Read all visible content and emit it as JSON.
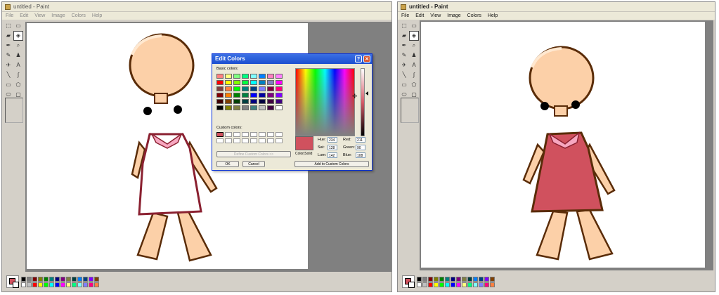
{
  "left_window": {
    "title": "untitled - Paint",
    "menu": [
      "File",
      "Edit",
      "View",
      "Image",
      "Colors",
      "Help"
    ]
  },
  "right_window": {
    "title": "untitled - Paint",
    "menu": [
      "File",
      "Edit",
      "View",
      "Image",
      "Colors",
      "Help"
    ]
  },
  "tools": [
    {
      "icon": "free-form-select-icon",
      "glyph": "⬚"
    },
    {
      "icon": "rect-select-icon",
      "glyph": "▭"
    },
    {
      "icon": "eraser-icon",
      "glyph": "▰"
    },
    {
      "icon": "fill-bucket-icon",
      "glyph": "◈"
    },
    {
      "icon": "color-picker-icon",
      "glyph": "✒"
    },
    {
      "icon": "magnifier-icon",
      "glyph": "⌕"
    },
    {
      "icon": "pencil-icon",
      "glyph": "✎"
    },
    {
      "icon": "brush-icon",
      "glyph": "♟"
    },
    {
      "icon": "airbrush-icon",
      "glyph": "✈"
    },
    {
      "icon": "text-icon",
      "glyph": "A"
    },
    {
      "icon": "line-icon",
      "glyph": "╲"
    },
    {
      "icon": "curve-icon",
      "glyph": "∫"
    },
    {
      "icon": "rectangle-icon",
      "glyph": "▭"
    },
    {
      "icon": "polygon-icon",
      "glyph": "⬠"
    },
    {
      "icon": "ellipse-icon",
      "glyph": "⬭"
    },
    {
      "icon": "rounded-rect-icon",
      "glyph": "▢"
    }
  ],
  "palette": [
    "#000000",
    "#808080",
    "#800000",
    "#808000",
    "#008000",
    "#008080",
    "#000080",
    "#800080",
    "#808040",
    "#004040",
    "#0080ff",
    "#004080",
    "#8000ff",
    "#804000",
    "#ffffff",
    "#c0c0c0",
    "#ff0000",
    "#ffff00",
    "#00ff00",
    "#00ffff",
    "#0000ff",
    "#ff00ff",
    "#ffff80",
    "#00ff80",
    "#80ffff",
    "#8080ff",
    "#ff0080",
    "#ff8040"
  ],
  "colors": {
    "dress": "#d0515e",
    "skin": "#fcd0a8",
    "skin_shade": "#f1b07c",
    "outline": "#5a2c08",
    "collar": "#f7a7c0",
    "dress_outline": "#8a2030"
  },
  "dialog": {
    "title": "Edit Colors",
    "help": "?",
    "close": "✕",
    "basic_label": "Basic colors:",
    "custom_label": "Custom colors:",
    "define_button": "Define Custom Colors >>",
    "ok_button": "OK",
    "cancel_button": "Cancel",
    "add_button": "Add to Custom Colors",
    "color_solid_label": "Color|Solid",
    "hue_label": "Hue:",
    "hue": "234",
    "sat_label": "Sat:",
    "sat": "128",
    "lum_label": "Lum:",
    "lum": "142",
    "red_label": "Red:",
    "red": "211",
    "green_label": "Green:",
    "green": "90",
    "blue_label": "Blue:",
    "blue": "108",
    "basic_colors": [
      "#ff8080",
      "#ffff80",
      "#80ff80",
      "#00ff80",
      "#80ffff",
      "#0080ff",
      "#ff80c0",
      "#ff80ff",
      "#ff0000",
      "#ffff00",
      "#80ff00",
      "#00ff40",
      "#00ffff",
      "#0080c0",
      "#8080c0",
      "#ff00ff",
      "#804040",
      "#ff8040",
      "#00ff00",
      "#008080",
      "#004080",
      "#8080ff",
      "#800040",
      "#ff0080",
      "#800000",
      "#ff8000",
      "#008000",
      "#008040",
      "#0000ff",
      "#0000a0",
      "#800080",
      "#8000ff",
      "#400000",
      "#804000",
      "#004000",
      "#004040",
      "#000080",
      "#000040",
      "#400040",
      "#400080",
      "#000000",
      "#808000",
      "#808040",
      "#808080",
      "#408080",
      "#c0c0c0",
      "#400040",
      "#ffffff"
    ]
  }
}
